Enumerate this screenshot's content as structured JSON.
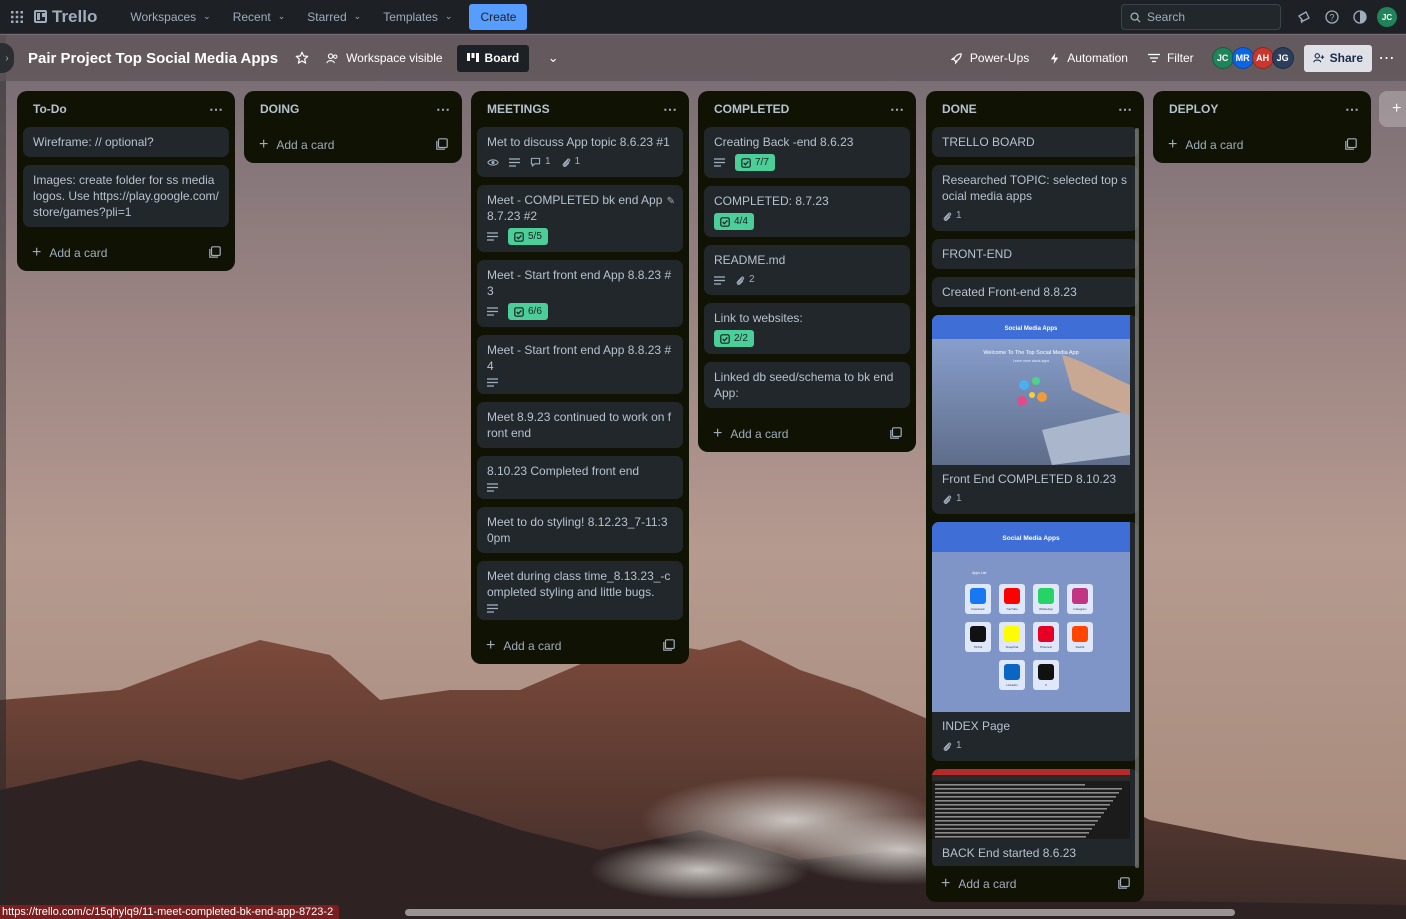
{
  "nav": {
    "logo": "Trello",
    "items": [
      "Workspaces",
      "Recent",
      "Starred",
      "Templates"
    ],
    "create_label": "Create",
    "search_placeholder": "Search",
    "user_initials": "JC"
  },
  "board": {
    "title": "Pair Project Top Social Media Apps",
    "visibility": "Workspace visible",
    "view_label": "Board",
    "powerups": "Power-Ups",
    "automation": "Automation",
    "filter": "Filter",
    "members": [
      {
        "initials": "JC",
        "color": "#1f845a"
      },
      {
        "initials": "MR",
        "color": "#0c66e4"
      },
      {
        "initials": "AH",
        "color": "#c9372c"
      },
      {
        "initials": "JG",
        "color": "#2c3e5d"
      }
    ],
    "share": "Share"
  },
  "lists": [
    {
      "name": "To-Do",
      "cards": [
        {
          "title": "Wireframe: // optional?"
        },
        {
          "title": "Images: create folder for ss media logos. Use https://play.google.com/store/games?pli=1"
        }
      ],
      "add": "Add a card"
    },
    {
      "name": "DOING",
      "cards": [],
      "add": "Add a card"
    },
    {
      "name": "MEETINGS",
      "cards": [
        {
          "title": "Met to discuss App topic 8.6.23 #1",
          "watch": true,
          "desc": true,
          "comments": "1",
          "attachments": "1"
        },
        {
          "title": "Meet - COMPLETED bk end App 8.7.23 #2",
          "desc": true,
          "checklist": "5/5",
          "edit": true
        },
        {
          "title": "Meet - Start front end App 8.8.23 #3",
          "desc": true,
          "checklist": "6/6"
        },
        {
          "title": "Meet - Start front end App 8.8.23 #4",
          "desc": true
        },
        {
          "title": "Meet 8.9.23 continued to work on front end"
        },
        {
          "title": "8.10.23 Completed front end",
          "desc": true
        },
        {
          "title": "Meet to do styling! 8.12.23_7-11:30pm"
        },
        {
          "title": "Meet during class time_8.13.23_-completed styling and little bugs.",
          "desc": true
        }
      ],
      "add": "Add a card"
    },
    {
      "name": "COMPLETED",
      "cards": [
        {
          "title": "Creating Back -end 8.6.23",
          "desc": true,
          "checklist": "7/7"
        },
        {
          "title": "COMPLETED: 8.7.23",
          "checklist": "4/4"
        },
        {
          "title": "README.md",
          "desc": true,
          "attachments": "2"
        },
        {
          "title": "Link to websites:",
          "checklist": "2/2"
        },
        {
          "title": "Linked db seed/schema to bk end App:"
        }
      ],
      "add": "Add a card"
    },
    {
      "name": "DONE",
      "cards": [
        {
          "title": "TRELLO BOARD"
        },
        {
          "title": "Researched TOPIC: selected top social media apps",
          "attachments": "1"
        },
        {
          "title": "FRONT-END"
        },
        {
          "title": "Created Front-end 8.8.23"
        },
        {
          "title": "Front End COMPLETED 8.10.23",
          "attachments": "1",
          "cover": "frontend",
          "cover_text": {
            "header": "Social Media Apps",
            "headline": "Welcome To The Top Social Media App",
            "sub": "Learn more about apps"
          }
        },
        {
          "title": "INDEX Page",
          "attachments": "1",
          "cover": "index",
          "cover_text": {
            "header": "Social Media Apps",
            "list_label": "Apps List",
            "apps": [
              "Facebook",
              "YouTube",
              "WhatsApp",
              "Instagram",
              "TikTok",
              "Snapchat",
              "Pinterest",
              "Reddit",
              "LinkedIn",
              "X"
            ]
          }
        },
        {
          "title": "BACK End started 8.6.23",
          "cover": "backend"
        }
      ],
      "add": "Add a card"
    },
    {
      "name": "DEPLOY",
      "cards": [],
      "add": "Add a card"
    }
  ],
  "status_url": "https://trello.com/c/15qhylq9/11-meet-completed-bk-end-app-8723-2"
}
